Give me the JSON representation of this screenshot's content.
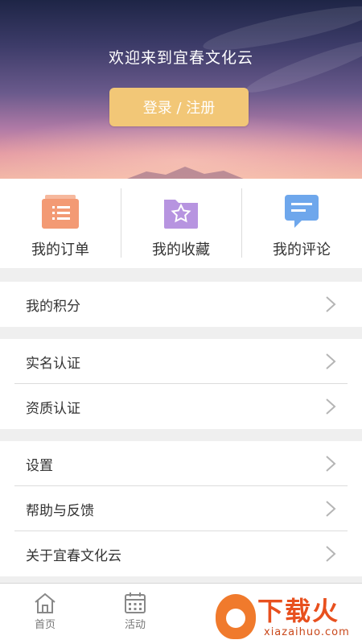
{
  "header": {
    "welcome": "欢迎来到宜春文化云",
    "login_label": "登录 / 注册"
  },
  "quick_actions": [
    {
      "label": "我的订单",
      "icon": "orders-icon",
      "color": "#f39a74"
    },
    {
      "label": "我的收藏",
      "icon": "favorites-icon",
      "color": "#b794e0"
    },
    {
      "label": "我的评论",
      "icon": "comments-icon",
      "color": "#6ea7ec"
    }
  ],
  "menu": {
    "points": "我的积分",
    "realname": "实名认证",
    "qualification": "资质认证",
    "settings": "设置",
    "help": "帮助与反馈",
    "about": "关于宜春文化云"
  },
  "tabbar": [
    {
      "label": "首页",
      "icon": "home-icon"
    },
    {
      "label": "活动",
      "icon": "calendar-icon"
    }
  ],
  "watermark": {
    "title": "下载火",
    "site": "xiazaihuo.com"
  },
  "colors": {
    "accent_button": "#f2c777",
    "watermark": "#e8501e"
  }
}
